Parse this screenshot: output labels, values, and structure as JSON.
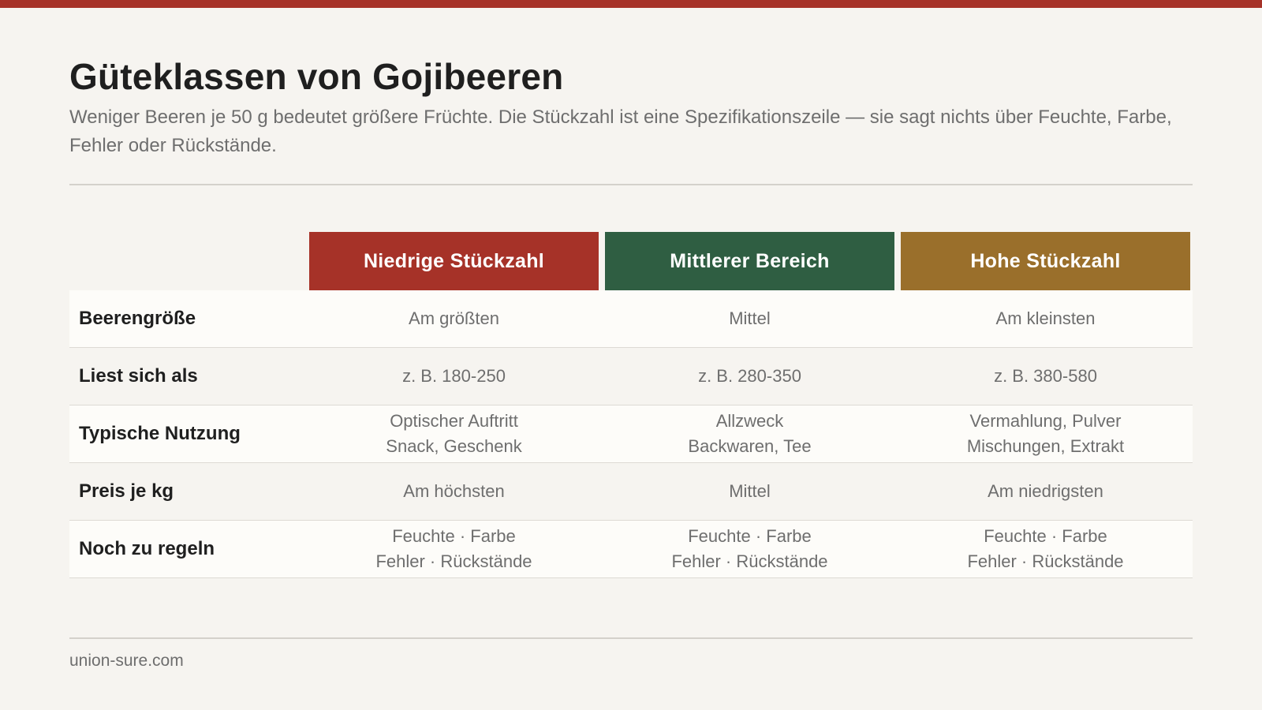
{
  "colors": {
    "accent_bar": "#a63228",
    "low_count": "#a63228",
    "mid_range": "#2f5e42",
    "high_count": "#9a6f2b"
  },
  "title": "Güteklassen von Gojibeeren",
  "subtitle": "Weniger Beeren je 50 g bedeutet größere Früchte. Die Stückzahl ist eine Spezifikationszeile — sie sagt nichts über Feuchte, Farbe, Fehler oder Rückstände.",
  "columns": [
    "Niedrige Stückzahl",
    "Mittlerer Bereich",
    "Hohe Stückzahl"
  ],
  "rows": [
    {
      "label": "Beerengröße",
      "cells": [
        [
          "Am größten"
        ],
        [
          "Mittel"
        ],
        [
          "Am kleinsten"
        ]
      ]
    },
    {
      "label": "Liest sich als",
      "cells": [
        [
          "z. B. 180-250"
        ],
        [
          "z. B. 280-350"
        ],
        [
          "z. B. 380-580"
        ]
      ]
    },
    {
      "label": "Typische Nutzung",
      "cells": [
        [
          "Optischer Auftritt",
          "Snack, Geschenk"
        ],
        [
          "Allzweck",
          "Backwaren, Tee"
        ],
        [
          "Vermahlung, Pulver",
          "Mischungen, Extrakt"
        ]
      ]
    },
    {
      "label": "Preis je kg",
      "cells": [
        [
          "Am höchsten"
        ],
        [
          "Mittel"
        ],
        [
          "Am niedrigsten"
        ]
      ]
    },
    {
      "label": "Noch zu regeln",
      "cells": [
        [
          "Feuchte · Farbe",
          "Fehler · Rückstände"
        ],
        [
          "Feuchte · Farbe",
          "Fehler · Rückstände"
        ],
        [
          "Feuchte · Farbe",
          "Fehler · Rückstände"
        ]
      ]
    }
  ],
  "footer": "union-sure.com"
}
